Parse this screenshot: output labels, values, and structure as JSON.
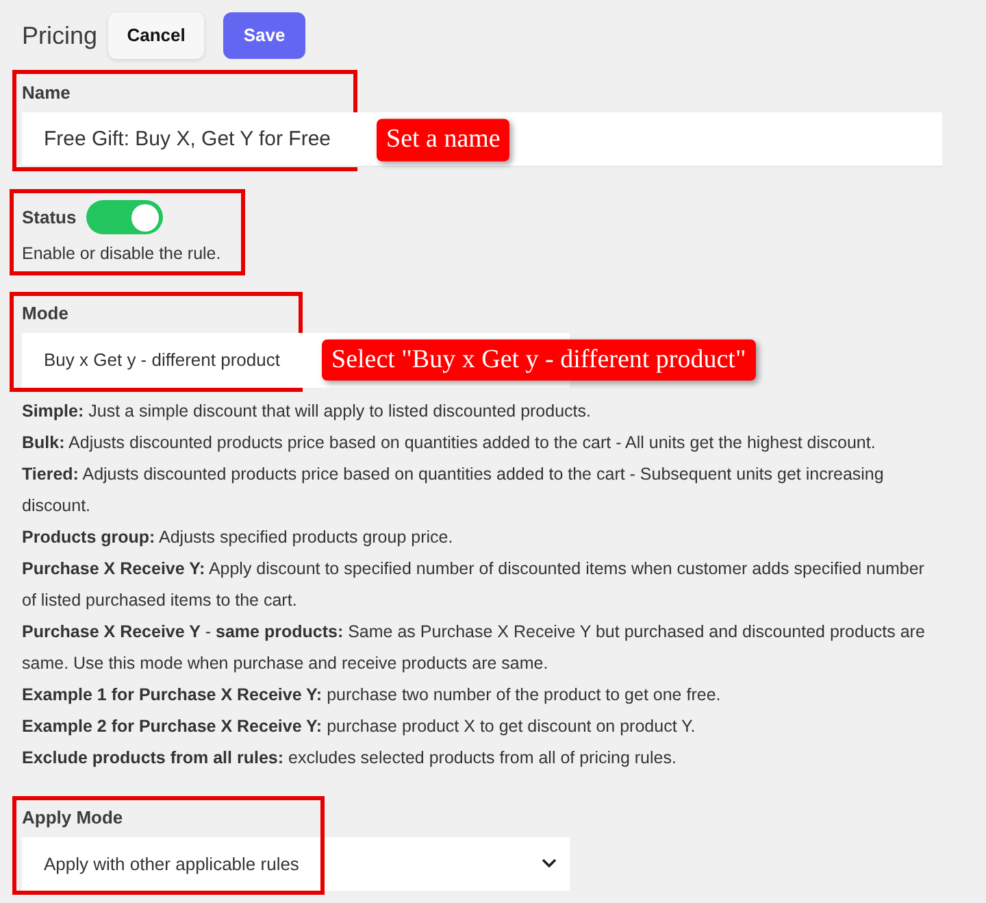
{
  "header": {
    "title": "Pricing",
    "buttons": [
      {
        "label": "Cancel",
        "kind": "secondary"
      },
      {
        "label": "Save",
        "kind": "primary"
      }
    ]
  },
  "name_field": {
    "label": "Name",
    "value": "Free Gift: Buy X, Get Y for Free",
    "highlighted": true,
    "annotation": "Set a name"
  },
  "status": {
    "label": "Status",
    "on": true,
    "help": "Enable or disable the rule.",
    "highlighted": true
  },
  "mode": {
    "label": "Mode",
    "value": "Buy x Get y - different product",
    "highlighted": true,
    "annotation": "Select \"Buy x Get y - different product\""
  },
  "mode_descriptions": [
    "**Simple:** Just a simple discount that will apply to listed discounted products.",
    "**Bulk:** Adjusts discounted products price based on quantities added to the cart - All units get the highest discount.",
    "**Tiered:** Adjusts discounted products price based on quantities added to the cart - Subsequent units get increasing discount.",
    "**Products group:** Adjusts specified products group price.",
    "**Purchase X Receive Y:** Apply discount to specified number of discounted items when customer adds specified number of listed purchased items to the cart.",
    "**Purchase X Receive Y** - **same products:** Same as Purchase X Receive Y but purchased and discounted products are same. Use this mode when purchase and receive products are same.",
    "**Example 1 for Purchase X Receive Y:** purchase two number of the product to get one free.",
    "**Example 2 for Purchase X Receive Y:** purchase product X to get discount on product Y.",
    "**Exclude products from all rules:** excludes selected products from all of pricing rules."
  ],
  "apply_mode": {
    "label": "Apply Mode",
    "value": "Apply with other applicable rules",
    "highlighted": true
  }
}
